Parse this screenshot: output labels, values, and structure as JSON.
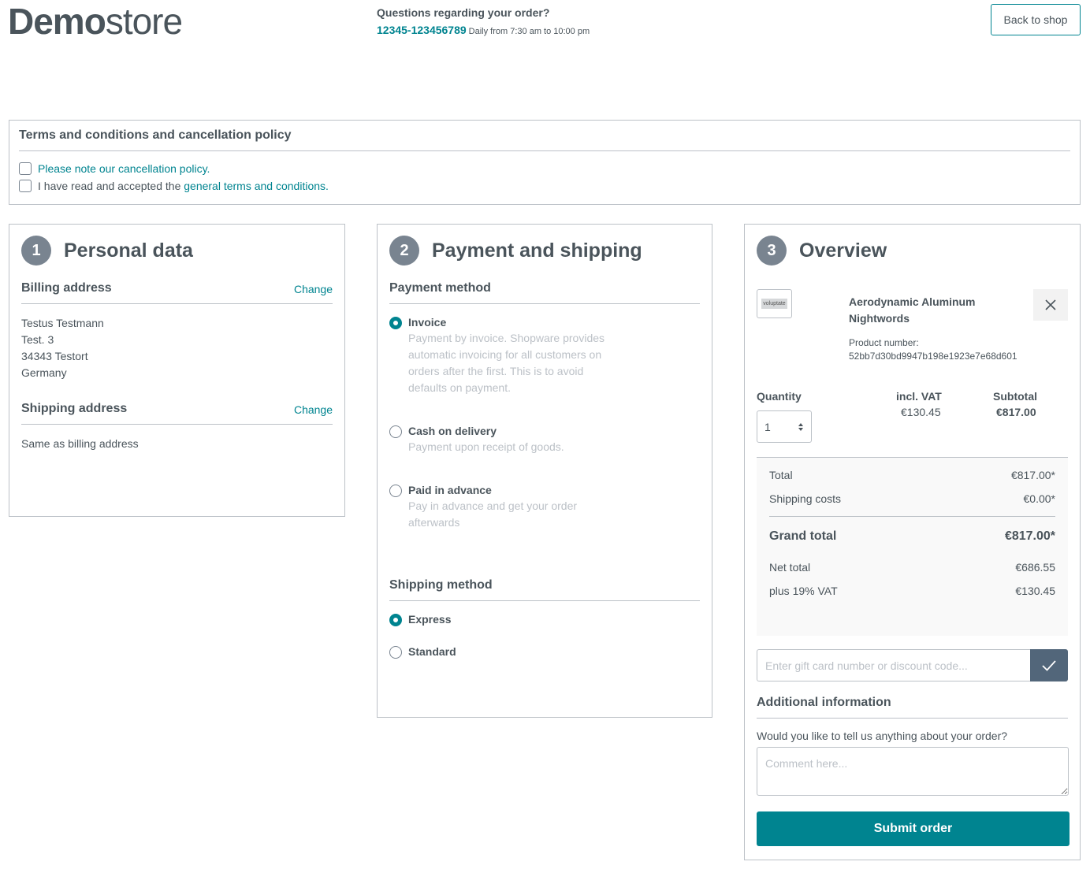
{
  "header": {
    "logo_bold": "Demo",
    "logo_light": "store",
    "hotline_question": "Questions regarding your order?",
    "hotline_number": "12345-123456789",
    "hotline_hours": "Daily from 7:30 am to 10:00 pm",
    "back_label": "Back to shop"
  },
  "terms": {
    "title": "Terms and conditions and cancellation policy",
    "cancellation_text": "Please note our cancellation policy.",
    "accept_prefix": "I have read and accepted the ",
    "accept_link": "general terms and conditions",
    "accept_suffix": "."
  },
  "personal": {
    "step": "1",
    "title": "Personal data",
    "billing_title": "Billing address",
    "change_label": "Change",
    "billing_lines": [
      "Testus Testmann",
      "Test. 3",
      "34343 Testort",
      "Germany"
    ],
    "shipping_title": "Shipping address",
    "shipping_text": "Same as billing address"
  },
  "payment": {
    "step": "2",
    "title": "Payment and shipping",
    "payment_title": "Payment method",
    "methods": [
      {
        "label": "Invoice",
        "desc": "Payment by invoice. Shopware provides automatic invoicing for all customers on orders after the first. This is to avoid defaults on payment.",
        "selected": true
      },
      {
        "label": "Cash on delivery",
        "desc": "Payment upon receipt of goods.",
        "selected": false
      },
      {
        "label": "Paid in advance",
        "desc": "Pay in advance and get your order afterwards",
        "selected": false
      }
    ],
    "shipping_title": "Shipping method",
    "shipping_methods": [
      {
        "label": "Express",
        "selected": true
      },
      {
        "label": "Standard",
        "selected": false
      }
    ]
  },
  "overview": {
    "step": "3",
    "title": "Overview",
    "product": {
      "thumb_text": "voluptate",
      "name": "Aerodynamic Aluminum Nightwords",
      "number_label": "Product number:",
      "number": "52bb7d30bd9947b198e1923e7e68d601"
    },
    "columns": {
      "quantity": "Quantity",
      "vat": "incl. VAT",
      "subtotal": "Subtotal"
    },
    "quantity": "1",
    "unit_price": "€130.45",
    "subtotal": "€817.00",
    "summary": {
      "total_label": "Total",
      "total": "€817.00*",
      "shipping_label": "Shipping costs",
      "shipping": "€0.00*",
      "grand_label": "Grand total",
      "grand": "€817.00*",
      "net_label": "Net total",
      "net": "€686.55",
      "vat_label": "plus 19% VAT",
      "vat": "€130.45"
    },
    "voucher_placeholder": "Enter gift card number or discount code...",
    "additional_title": "Additional information",
    "additional_question": "Would you like to tell us anything about your order?",
    "comment_placeholder": "Comment here...",
    "submit_label": "Submit order"
  },
  "colors": {
    "accent": "#008490",
    "text": "#4a545b",
    "border": "#bcc1c7",
    "step_badge": "#798490",
    "voucher_button": "#52667a"
  }
}
